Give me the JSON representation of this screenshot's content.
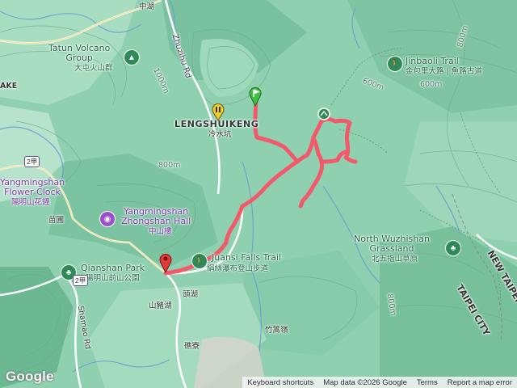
{
  "map": {
    "colors": {
      "terrain": "#8fd0b0",
      "trail": "#f25a6c",
      "start_pin": "#3fbf3f",
      "end_pin": "#e03a3a",
      "park": "#2e8a57",
      "hall": "#9c4fc9",
      "bus": "#f4cc28"
    },
    "labels": {
      "zhonghu": "中湖",
      "tatun_en": "Tatun Volcano\nGroup",
      "tatun_zh": "大屯火山群",
      "zhuzihu_rd": "Zhuzihu Rd",
      "lengshuikeng_en": "LENGSHUIKENG",
      "lengshuikeng_zh": "冷水坑",
      "jinbaoli_en": "Jinbaoli Trail",
      "jinbaoli_zh": "金包里大路 | 魚路古道",
      "lake_edge": "AKE",
      "flower_en": "Yangmingshan\nFlower Clock",
      "flower_zh": "陽明山花鐘",
      "zhongshan_en": "Yangmingshan\nZhongshan Hall",
      "zhongshan_zh": "中山樓",
      "miaopu": "苗圃",
      "qianshan_en": "Qianshan Park",
      "qianshan_zh": "陽明山前山公園",
      "juansi_en": "Juansi Falls Trail",
      "juansi_zh": "絹絲瀑布登山步道",
      "touhu": "頭湖",
      "shanzhuhu": "山豬湖",
      "zhusongling": "竹篙嶺",
      "jiliao": "礁寮",
      "wuzhishan_en": "North Wuzhishan\nGrassland",
      "wuzhishan_zh": "北五指山草原",
      "new_taipei": "NEW TAIPEI",
      "taipei_city": "TAIPEI CITY",
      "shamao_rd": "Shamao Rd",
      "shield_2jia_top": "2甲",
      "shield_2jia_bottom": "2甲"
    },
    "contours": {
      "c1": "1000m",
      "c2": "800m",
      "c3": "600m",
      "c4": "600m",
      "c5": "800m",
      "c6": "800m"
    },
    "footer": {
      "brand": "Google",
      "shortcuts": "Keyboard shortcuts",
      "mapdata": "Map data ©2026 Google",
      "terms": "Terms",
      "report": "Report a map error"
    }
  }
}
